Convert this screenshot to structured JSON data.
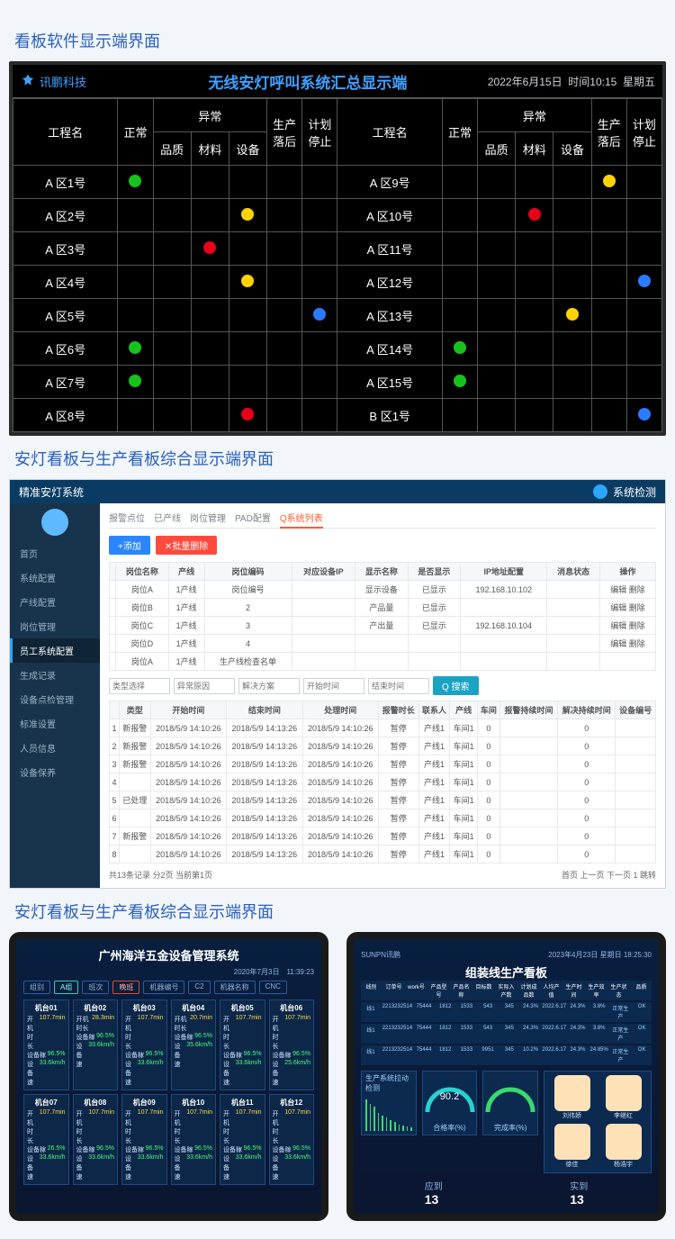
{
  "section1_title": "看板软件显示端界面",
  "andon": {
    "brand": "讯鹏科技",
    "title": "无线安灯呼叫系统汇总显示端",
    "date": "2022年6月15日",
    "time_label": "时间",
    "time": "10:15",
    "weekday": "星期五",
    "head": {
      "name": "工程名",
      "normal": "正常",
      "abnormal": "异常",
      "quality": "品质",
      "material": "材料",
      "equipment": "设备",
      "prod_delay": "生产落后",
      "plan_stop": "计划停止"
    },
    "rows_left": [
      {
        "name": "A 区1号",
        "c": [
          "g",
          "",
          "",
          "",
          "",
          ""
        ]
      },
      {
        "name": "A 区2号",
        "c": [
          "",
          "",
          "",
          "y",
          "",
          ""
        ]
      },
      {
        "name": "A 区3号",
        "c": [
          "",
          "",
          "r",
          "",
          "",
          ""
        ]
      },
      {
        "name": "A 区4号",
        "c": [
          "",
          "",
          "",
          "y",
          "",
          ""
        ]
      },
      {
        "name": "A 区5号",
        "c": [
          "",
          "",
          "",
          "",
          "",
          "b"
        ]
      },
      {
        "name": "A 区6号",
        "c": [
          "g",
          "",
          "",
          "",
          "",
          ""
        ]
      },
      {
        "name": "A 区7号",
        "c": [
          "g",
          "",
          "",
          "",
          "",
          ""
        ]
      },
      {
        "name": "A 区8号",
        "c": [
          "",
          "",
          "",
          "r",
          "",
          ""
        ]
      }
    ],
    "rows_right": [
      {
        "name": "A 区9号",
        "c": [
          "",
          "",
          "",
          "",
          "y",
          ""
        ]
      },
      {
        "name": "A 区10号",
        "c": [
          "",
          "",
          "r",
          "",
          "",
          ""
        ]
      },
      {
        "name": "A 区11号",
        "c": [
          "",
          "",
          "",
          "",
          "",
          ""
        ]
      },
      {
        "name": "A 区12号",
        "c": [
          "",
          "",
          "",
          "",
          "",
          "b"
        ]
      },
      {
        "name": "A 区13号",
        "c": [
          "",
          "",
          "",
          "y",
          "",
          ""
        ]
      },
      {
        "name": "A 区14号",
        "c": [
          "g",
          "",
          "",
          "",
          "",
          ""
        ]
      },
      {
        "name": "A 区15号",
        "c": [
          "g",
          "",
          "",
          "",
          "",
          ""
        ]
      },
      {
        "name": "B 区1号",
        "c": [
          "",
          "",
          "",
          "",
          "",
          "b"
        ]
      }
    ]
  },
  "section2_title": "安灯看板与生产看板综合显示端界面",
  "web": {
    "top_title": "精准安灯系统",
    "user": "系统检测",
    "side": [
      "首页",
      "系统配置",
      "产线配置",
      "岗位管理",
      "员工系统配置",
      "生成记录",
      "设备点检管理",
      "标准设置",
      "人员信息",
      "设备保养"
    ],
    "side_active_index": 4,
    "tabs": [
      "报警点位",
      "已产线",
      "岗位管理",
      "PAD配置",
      "Q系统列表"
    ],
    "tabs_active": 4,
    "btn_add": "+添加",
    "btn_del": "✕批量删除",
    "btn_search": "Q 搜索",
    "table1_head": [
      "",
      "岗位名称",
      "产线",
      "岗位编码",
      "对应设备IP",
      "显示名称",
      "是否显示",
      "IP地址配置",
      "消息状态",
      "操作"
    ],
    "table1_rows": [
      [
        "",
        "岗位A",
        "1产线",
        "岗位编号",
        "",
        "显示设备",
        "已显示",
        "192.168.10.102",
        "",
        "编辑 删除"
      ],
      [
        "",
        "岗位B",
        "1产线",
        "2",
        "",
        "产品量",
        "已显示",
        "",
        "",
        "编辑 删除"
      ],
      [
        "",
        "岗位C",
        "1产线",
        "3",
        "",
        "产出量",
        "已显示",
        "192.168.10.104",
        "",
        "编辑 删除"
      ],
      [
        "",
        "岗位D",
        "1产线",
        "4",
        "",
        "",
        "",
        "",
        "",
        "编辑 删除"
      ],
      [
        "",
        "岗位A",
        "1产线",
        "生产线检查名单",
        "",
        "",
        "",
        "",
        "",
        ""
      ]
    ],
    "filters": [
      "类型选择",
      "异常原因",
      "解决方案",
      "开始时间",
      "结束时间"
    ],
    "table2_head": [
      "",
      "类型",
      "开始时间",
      "结束时间",
      "处理时间",
      "报警时长",
      "联系人",
      "产线",
      "车间",
      "报警持续时间",
      "解决持续时间",
      "设备编号"
    ],
    "table2_rows": [
      [
        "1",
        "新报警",
        "2018/5/9 14:10:26",
        "2018/5/9 14:13:26",
        "2018/5/9 14:10:26",
        "暂停",
        "产线1",
        "车间1",
        "0",
        "",
        "0",
        ""
      ],
      [
        "2",
        "新报警",
        "2018/5/9 14:10:26",
        "2018/5/9 14:13:26",
        "2018/5/9 14:10:26",
        "暂停",
        "产线1",
        "车间1",
        "0",
        "",
        "0",
        ""
      ],
      [
        "3",
        "新报警",
        "2018/5/9 14:10:26",
        "2018/5/9 14:13:26",
        "2018/5/9 14:10:26",
        "暂停",
        "产线1",
        "车间1",
        "0",
        "",
        "0",
        ""
      ],
      [
        "4",
        "",
        "2018/5/9 14:10:26",
        "2018/5/9 14:13:26",
        "2018/5/9 14:10:26",
        "暂停",
        "产线1",
        "车间1",
        "0",
        "",
        "0",
        ""
      ],
      [
        "5",
        "已处理",
        "2018/5/9 14:10:26",
        "2018/5/9 14:13:26",
        "2018/5/9 14:10:26",
        "暂停",
        "产线1",
        "车间1",
        "0",
        "",
        "0",
        ""
      ],
      [
        "6",
        "",
        "2018/5/9 14:10:26",
        "2018/5/9 14:13:26",
        "2018/5/9 14:10:26",
        "暂停",
        "产线1",
        "车间1",
        "0",
        "",
        "0",
        ""
      ],
      [
        "7",
        "新报警",
        "2018/5/9 14:10:26",
        "2018/5/9 14:13:26",
        "2018/5/9 14:10:26",
        "暂停",
        "产线1",
        "车间1",
        "0",
        "",
        "0",
        ""
      ],
      [
        "8",
        "",
        "2018/5/9 14:10:26",
        "2018/5/9 14:13:26",
        "2018/5/9 14:10:26",
        "暂停",
        "产线1",
        "车间1",
        "0",
        "",
        "0",
        ""
      ]
    ],
    "pager_count": "共13条记录 分2页 当前第1页",
    "pager_nav": "首页 上一页 下一页 1 跳转"
  },
  "section3_title": "安灯看板与生产看板综合显示端界面",
  "dash1": {
    "title": "广州海洋五金设备管理系统",
    "datetime": "2020年7月3日　11:39:23",
    "tags": [
      "组别",
      "A组",
      "班次",
      "晚班",
      "机器编号",
      "C2",
      "机器名称",
      "CNC"
    ],
    "machines": [
      {
        "n": "机台01",
        "t": "107.7min",
        "r": "96.5%",
        "s": "33.6km/h"
      },
      {
        "n": "机台02",
        "t": "28.3min",
        "r": "96.5%",
        "s": "33.6km/h"
      },
      {
        "n": "机台03",
        "t": "107.7min",
        "r": "96.5%",
        "s": "33.6km/h"
      },
      {
        "n": "机台04",
        "t": "20.7min",
        "r": "96.5%",
        "s": "35.6km/h"
      },
      {
        "n": "机台05",
        "t": "107.7min",
        "r": "96.5%",
        "s": "33.6km/h"
      },
      {
        "n": "机台06",
        "t": "107.7min",
        "r": "96.5%",
        "s": "25.6km/h"
      },
      {
        "n": "机台07",
        "t": "107.7min",
        "r": "26.5%",
        "s": "33.6km/h"
      },
      {
        "n": "机台08",
        "t": "107.7min",
        "r": "96.5%",
        "s": "33.6km/h"
      },
      {
        "n": "机台09",
        "t": "107.7min",
        "r": "96.5%",
        "s": "33.6km/h"
      },
      {
        "n": "机台10",
        "t": "107.7min",
        "r": "96.5%",
        "s": "33.6km/h"
      },
      {
        "n": "机台11",
        "t": "107.7min",
        "r": "96.5%",
        "s": "33.6km/h"
      },
      {
        "n": "机台12",
        "t": "107.7min",
        "r": "96.5%",
        "s": "33.6km/h"
      }
    ],
    "row_labels": {
      "t": "开机时长",
      "r": "设备稼",
      "s": "设备速"
    }
  },
  "dash2": {
    "brand": "SUNPN讯鹏",
    "title": "组装线生产看板",
    "datetime": "2023年4月23日 星期日 18:25:30",
    "grid_head": [
      "线别",
      "订单号",
      "work号",
      "产品型号",
      "产品名称",
      "目标数",
      "实际入产数",
      "计划成品数",
      "人均产值",
      "生产时间",
      "生产效率",
      "生产状态",
      "品质"
    ],
    "grid_rows": [
      [
        "线1",
        "2213232514",
        "75444",
        "1812",
        "1533",
        "543",
        "345",
        "24.3%",
        "2022.6.17",
        "24.3%",
        "3.8%",
        "正常生产",
        "OK"
      ],
      [
        "线1",
        "2213232514",
        "75444",
        "1812",
        "1533",
        "543",
        "345",
        "24.3%",
        "2022.6.17",
        "24.3%",
        "3.8%",
        "正常生产",
        "OK"
      ],
      [
        "线1",
        "2213232514",
        "75444",
        "1812",
        "1533",
        "9951",
        "345",
        "10.2%",
        "2022.6.17",
        "24.3%",
        "24.85%",
        "正常生产",
        "OK"
      ]
    ],
    "chart1_label": "生产系统拉动检测",
    "chart2_label": "合格率(%)",
    "gauge_value": "90.2",
    "chart3_label": "完成率(%)",
    "people": [
      "刘伟娇",
      "李继红",
      "徐佳",
      "杨浩宇"
    ],
    "foot": [
      {
        "l": "应到",
        "v": "13"
      },
      {
        "l": "实到",
        "v": "13"
      }
    ]
  }
}
